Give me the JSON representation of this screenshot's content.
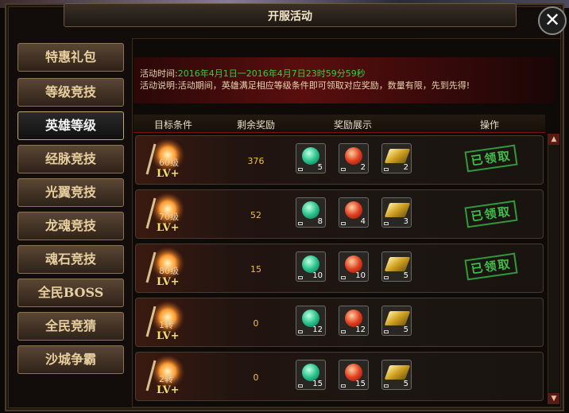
{
  "window": {
    "title": "开服活动",
    "close_label": "✕"
  },
  "sidebar": {
    "items": [
      {
        "label": "特惠礼包"
      },
      {
        "label": "等级竞技"
      },
      {
        "label": "英雄等级",
        "active": true
      },
      {
        "label": "经脉竞技"
      },
      {
        "label": "光翼竞技"
      },
      {
        "label": "龙魂竞技"
      },
      {
        "label": "魂石竞技"
      },
      {
        "label": "全民BOSS"
      },
      {
        "label": "全民竞猜"
      },
      {
        "label": "沙城争霸"
      }
    ]
  },
  "info": {
    "time_label": "活动时间:",
    "time_value": "2016年4月1日一2016年4月7日23时59分59秒",
    "desc_label": "活动说明:",
    "desc_value": "活动期间，英雄满足相应等级条件即可领取对应奖励，数量有限，先到先得!"
  },
  "table": {
    "headers": [
      "目标条件",
      "剩余奖励",
      "奖励展示",
      "操作"
    ],
    "level_icon_text": "LV+",
    "rows": [
      {
        "target": "60级",
        "remaining": "376",
        "items": [
          "5",
          "2",
          "2"
        ],
        "status": "已领取"
      },
      {
        "target": "70级",
        "remaining": "52",
        "items": [
          "8",
          "4",
          "3"
        ],
        "status": "已领取"
      },
      {
        "target": "80级",
        "remaining": "15",
        "items": [
          "10",
          "10",
          "5"
        ],
        "status": "已领取"
      },
      {
        "target": "1转",
        "remaining": "0",
        "items": [
          "12",
          "12",
          "5"
        ],
        "status": ""
      },
      {
        "target": "2转",
        "remaining": "0",
        "items": [
          "15",
          "15",
          "5"
        ],
        "status": ""
      }
    ]
  },
  "colors": {
    "accent_green": "#30d040",
    "remaining_yellow": "#f0c040",
    "banner_red": "#5a0e0e"
  },
  "icons": {
    "item1": "green-gem-icon",
    "item2": "red-gem-icon",
    "item3": "gold-bar-icon",
    "close": "close-icon"
  }
}
